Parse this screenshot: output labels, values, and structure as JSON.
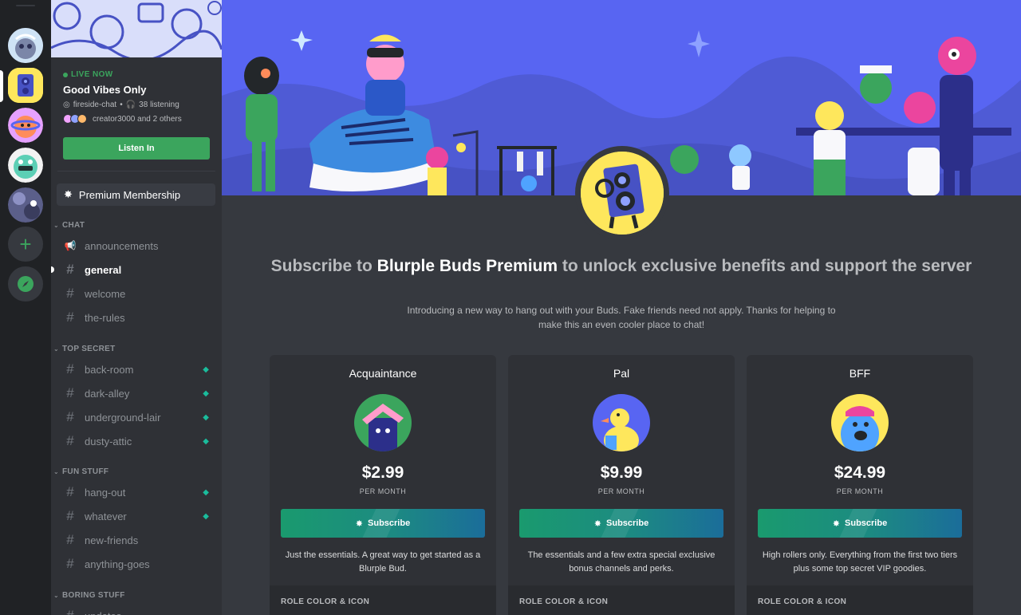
{
  "colors": {
    "blurple": "#5865f2",
    "green": "#3ba55d",
    "boost": "#1abc9c"
  },
  "stage": {
    "live_label": "LIVE NOW",
    "title": "Good Vibes Only",
    "channel": "fireside-chat",
    "separator": "•",
    "listening": "38 listening",
    "speakers": "creator3000 and 2 others",
    "listen_button": "Listen In"
  },
  "sidebar": {
    "premium_label": "Premium Membership",
    "categories": [
      {
        "name": "CHAT",
        "channels": [
          {
            "name": "announcements",
            "icon": "megaphone-icon"
          },
          {
            "name": "general",
            "icon": "hash-icon"
          },
          {
            "name": "welcome",
            "icon": "hash-icon"
          },
          {
            "name": "the-rules",
            "icon": "hash-icon"
          }
        ]
      },
      {
        "name": "TOP SECRET",
        "channels": [
          {
            "name": "back-room"
          },
          {
            "name": "dark-alley"
          },
          {
            "name": "underground-lair"
          },
          {
            "name": "dusty-attic"
          }
        ]
      },
      {
        "name": "FUN STUFF",
        "channels": [
          {
            "name": "hang-out"
          },
          {
            "name": "whatever"
          },
          {
            "name": "new-friends"
          },
          {
            "name": "anything-goes"
          }
        ]
      },
      {
        "name": "BORING STUFF",
        "channels": [
          {
            "name": "updates"
          }
        ]
      }
    ]
  },
  "main": {
    "headline_pre": "Subscribe to ",
    "headline_brand": "Blurple Buds Premium",
    "headline_post": " to unlock exclusive benefits and support the server",
    "subline": "Introducing a new way to hang out with your Buds. Fake friends need not apply. Thanks for helping to make this an even cooler place to chat!",
    "tiers": [
      {
        "name": "Acquaintance",
        "price": "$2.99",
        "period": "PER MONTH",
        "button": "Subscribe",
        "description": "Just the essentials. A great way to get started as a Blurple Bud.",
        "section": "ROLE COLOR & ICON"
      },
      {
        "name": "Pal",
        "price": "$9.99",
        "period": "PER MONTH",
        "button": "Subscribe",
        "description": "The essentials and a few extra special exclusive bonus channels and perks.",
        "section": "ROLE COLOR & ICON"
      },
      {
        "name": "BFF",
        "price": "$24.99",
        "period": "PER MONTH",
        "button": "Subscribe",
        "description": "High rollers only. Everything from the first two tiers plus some top secret VIP goodies.",
        "section": "ROLE COLOR & ICON"
      }
    ]
  }
}
